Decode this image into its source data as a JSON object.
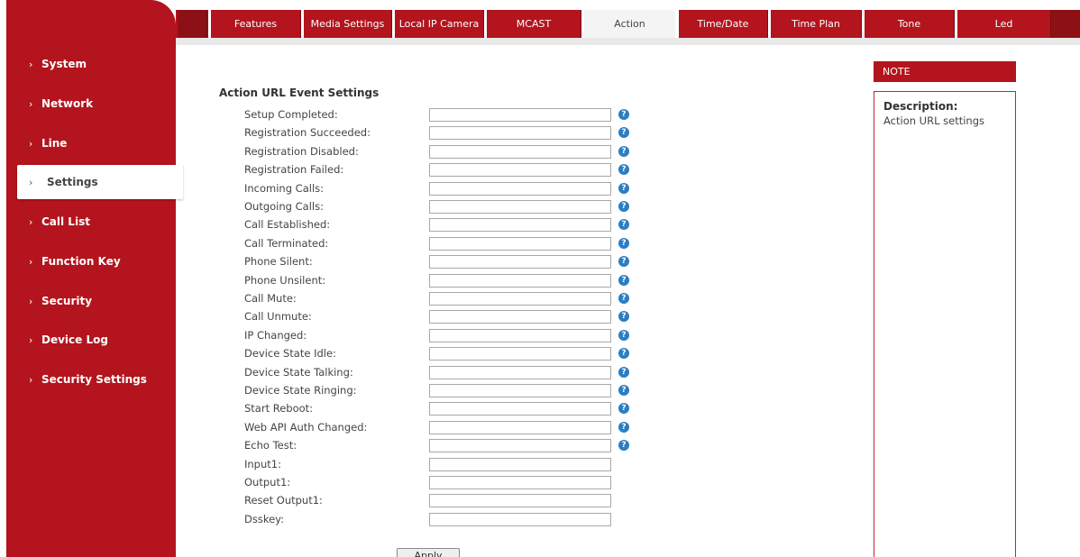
{
  "sidebar": {
    "items": [
      {
        "label": "System"
      },
      {
        "label": "Network"
      },
      {
        "label": "Line"
      },
      {
        "label": "Settings",
        "active": true
      },
      {
        "label": "Call List"
      },
      {
        "label": "Function Key"
      },
      {
        "label": "Security"
      },
      {
        "label": "Device Log"
      },
      {
        "label": "Security Settings"
      }
    ]
  },
  "tabs": [
    {
      "label": "Features"
    },
    {
      "label": "Media Settings"
    },
    {
      "label": "Local IP Camera"
    },
    {
      "label": "MCAST"
    },
    {
      "label": "Action",
      "active": true
    },
    {
      "label": "Time/Date"
    },
    {
      "label": "Time Plan"
    },
    {
      "label": "Tone"
    },
    {
      "label": "Led"
    }
  ],
  "main": {
    "section_title": "Action URL Event Settings",
    "fields": [
      {
        "label": "Setup Completed:",
        "value": "",
        "help": true
      },
      {
        "label": "Registration Succeeded:",
        "value": "",
        "help": true
      },
      {
        "label": "Registration Disabled:",
        "value": "",
        "help": true
      },
      {
        "label": "Registration Failed:",
        "value": "",
        "help": true
      },
      {
        "label": "Incoming Calls:",
        "value": "",
        "help": true
      },
      {
        "label": "Outgoing Calls:",
        "value": "",
        "help": true
      },
      {
        "label": "Call Established:",
        "value": "",
        "help": true
      },
      {
        "label": "Call Terminated:",
        "value": "",
        "help": true
      },
      {
        "label": "Phone Silent:",
        "value": "",
        "help": true
      },
      {
        "label": "Phone Unsilent:",
        "value": "",
        "help": true
      },
      {
        "label": "Call Mute:",
        "value": "",
        "help": true
      },
      {
        "label": "Call Unmute:",
        "value": "",
        "help": true
      },
      {
        "label": "IP Changed:",
        "value": "",
        "help": true
      },
      {
        "label": "Device State Idle:",
        "value": "",
        "help": true
      },
      {
        "label": "Device State Talking:",
        "value": "",
        "help": true
      },
      {
        "label": "Device State Ringing:",
        "value": "",
        "help": true
      },
      {
        "label": "Start Reboot:",
        "value": "",
        "help": true
      },
      {
        "label": "Web API Auth Changed:",
        "value": "",
        "help": true
      },
      {
        "label": "Echo Test:",
        "value": "",
        "help": true
      },
      {
        "label": "Input1:",
        "value": "",
        "help": false
      },
      {
        "label": "Output1:",
        "value": "",
        "help": false
      },
      {
        "label": "Reset Output1:",
        "value": "",
        "help": false
      },
      {
        "label": "Dsskey:",
        "value": "",
        "help": false
      }
    ],
    "apply_label": "Apply",
    "help_glyph": "?"
  },
  "note": {
    "header": "NOTE",
    "description_title": "Description:",
    "description_text": "Action URL settings"
  },
  "icons": {
    "sidebar_arrow": "›",
    "help": "question-circle-icon"
  },
  "colors": {
    "brand": "#b3141d",
    "help": "#2a7ec4"
  }
}
